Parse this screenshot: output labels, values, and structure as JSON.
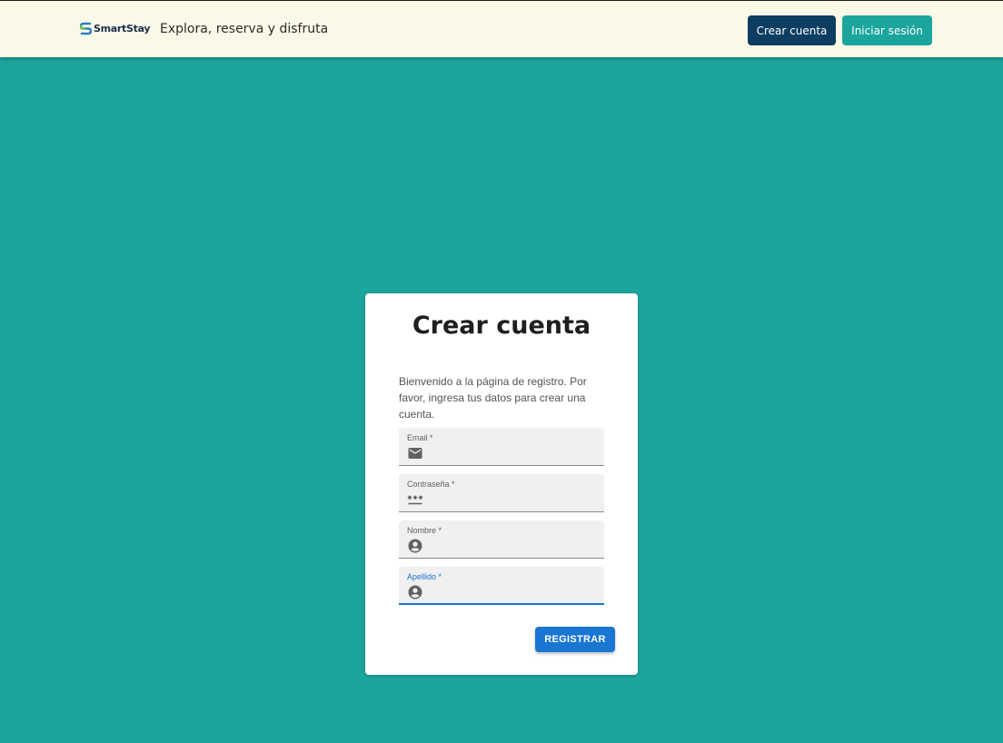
{
  "header": {
    "brand": "SmartStay",
    "tagline": "Explora, reserva y disfruta",
    "create_account_label": "Crear cuenta",
    "login_label": "Iniciar sesión"
  },
  "form": {
    "title": "Crear cuenta",
    "description": "Bienvenido a la página de registro. Por favor, ingresa tus datos para crear una cuenta.",
    "fields": [
      {
        "label": "Email *",
        "icon": "mail-icon",
        "value": ""
      },
      {
        "label": "Contraseña *",
        "icon": "password-icon",
        "value": ""
      },
      {
        "label": "Nombre *",
        "icon": "account-circle-icon",
        "value": ""
      },
      {
        "label": "Apellido *",
        "icon": "account-circle-icon",
        "value": "",
        "focused": true
      }
    ],
    "submit_label": "REGISTRAR"
  },
  "colors": {
    "background": "#1ca59d",
    "header_bg": "#faf9e8",
    "primary_dark": "#0d3e62",
    "accent": "#1ca59d",
    "submit": "#1976d2"
  }
}
